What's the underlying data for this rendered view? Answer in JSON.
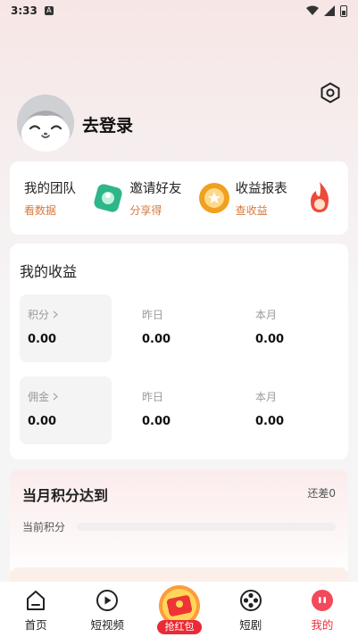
{
  "status_bar": {
    "time": "3:33",
    "notif_glyph": "A"
  },
  "profile": {
    "login_text": "去登录"
  },
  "shortcuts": [
    {
      "title": "我的团队",
      "sub": "看数据",
      "icon": "team-icon"
    },
    {
      "title": "邀请好友",
      "sub": "分享得",
      "icon": "invite-icon"
    },
    {
      "title": "收益报表",
      "sub": "查收益",
      "icon": "fire-icon"
    }
  ],
  "earnings": {
    "title": "我的收益",
    "rows": [
      {
        "label": "积分",
        "value": "0.00",
        "yesterday_label": "昨日",
        "yesterday": "0.00",
        "month_label": "本月",
        "month": "0.00"
      },
      {
        "label": "佣金",
        "value": "0.00",
        "yesterday_label": "昨日",
        "yesterday": "0.00",
        "month_label": "本月",
        "month": "0.00"
      }
    ]
  },
  "monthly": {
    "title": "当月积分达到",
    "remaining": "还差0",
    "current_label": "当前积分",
    "progress": 0
  },
  "tabbar": {
    "items": [
      {
        "label": "首页",
        "icon": "home-icon"
      },
      {
        "label": "短视频",
        "icon": "play-icon"
      },
      {
        "label": "抢红包",
        "icon": "red-packet-icon"
      },
      {
        "label": "短剧",
        "icon": "film-reel-icon"
      },
      {
        "label": "我的",
        "icon": "profile-icon"
      }
    ],
    "active_index": 4
  },
  "colors": {
    "accent": "#f02c3c",
    "sub_text": "#d9783a",
    "card": "#ffffff"
  }
}
